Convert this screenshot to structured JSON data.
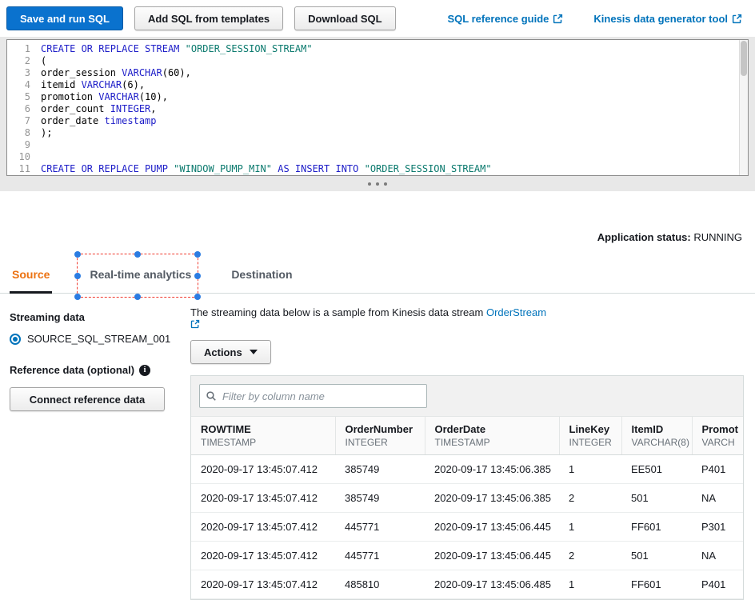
{
  "toolbar": {
    "save_run": "Save and run SQL",
    "add_templates": "Add SQL from templates",
    "download": "Download SQL",
    "reference_link": "SQL reference guide",
    "generator_link": "Kinesis data generator tool"
  },
  "editor": {
    "lines": [
      {
        "num": "1",
        "tokens": [
          [
            "kw",
            "CREATE OR REPLACE STREAM "
          ],
          [
            "str",
            "\"ORDER_SESSION_STREAM\""
          ]
        ]
      },
      {
        "num": "2",
        "tokens": [
          [
            "pl",
            "("
          ]
        ]
      },
      {
        "num": "3",
        "tokens": [
          [
            "pl",
            "order_session "
          ],
          [
            "kw",
            "VARCHAR"
          ],
          [
            "pl",
            "(60),"
          ]
        ]
      },
      {
        "num": "4",
        "tokens": [
          [
            "pl",
            "itemid "
          ],
          [
            "kw",
            "VARCHAR"
          ],
          [
            "pl",
            "(6),"
          ]
        ]
      },
      {
        "num": "5",
        "tokens": [
          [
            "pl",
            "promotion "
          ],
          [
            "kw",
            "VARCHAR"
          ],
          [
            "pl",
            "(10),"
          ]
        ]
      },
      {
        "num": "6",
        "tokens": [
          [
            "pl",
            "order_count "
          ],
          [
            "kw",
            "INTEGER"
          ],
          [
            "pl",
            ","
          ]
        ]
      },
      {
        "num": "7",
        "tokens": [
          [
            "pl",
            "order_date "
          ],
          [
            "kw",
            "timestamp"
          ]
        ]
      },
      {
        "num": "8",
        "tokens": [
          [
            "pl",
            ");"
          ]
        ]
      },
      {
        "num": "9",
        "tokens": []
      },
      {
        "num": "10",
        "tokens": []
      },
      {
        "num": "11",
        "tokens": [
          [
            "kw",
            "CREATE OR REPLACE PUMP "
          ],
          [
            "str",
            "\"WINDOW_PUMP_MIN\""
          ],
          [
            "pl",
            " "
          ],
          [
            "kw",
            "AS INSERT INTO "
          ],
          [
            "str",
            "\"ORDER_SESSION_STREAM\""
          ]
        ]
      }
    ]
  },
  "status": {
    "label": "Application status:",
    "value": "RUNNING"
  },
  "tabs": [
    {
      "label": "Source"
    },
    {
      "label": "Real-time analytics"
    },
    {
      "label": "Destination"
    }
  ],
  "sidebar": {
    "streaming_heading": "Streaming data",
    "stream_option": "SOURCE_SQL_STREAM_001",
    "reference_heading": "Reference data (optional)",
    "connect_button": "Connect reference data"
  },
  "main": {
    "sample_text_prefix": "The streaming data below is a sample from Kinesis data stream ",
    "stream_link": "OrderStream",
    "actions_label": "Actions",
    "filter_placeholder": "Filter by column name",
    "table": {
      "columns": [
        {
          "name": "ROWTIME",
          "type": "TIMESTAMP"
        },
        {
          "name": "OrderNumber",
          "type": "INTEGER"
        },
        {
          "name": "OrderDate",
          "type": "TIMESTAMP"
        },
        {
          "name": "LineKey",
          "type": "INTEGER"
        },
        {
          "name": "ItemID",
          "type": "VARCHAR(8)"
        },
        {
          "name": "Promot",
          "type": "VARCH"
        }
      ],
      "rows": [
        [
          "2020-09-17 13:45:07.412",
          "385749",
          "2020-09-17 13:45:06.385",
          "1",
          "EE501",
          "P401"
        ],
        [
          "2020-09-17 13:45:07.412",
          "385749",
          "2020-09-17 13:45:06.385",
          "2",
          "501",
          "NA"
        ],
        [
          "2020-09-17 13:45:07.412",
          "445771",
          "2020-09-17 13:45:06.445",
          "1",
          "FF601",
          "P301"
        ],
        [
          "2020-09-17 13:45:07.412",
          "445771",
          "2020-09-17 13:45:06.445",
          "2",
          "501",
          "NA"
        ],
        [
          "2020-09-17 13:45:07.412",
          "485810",
          "2020-09-17 13:45:06.485",
          "1",
          "FF601",
          "P401"
        ]
      ]
    }
  }
}
